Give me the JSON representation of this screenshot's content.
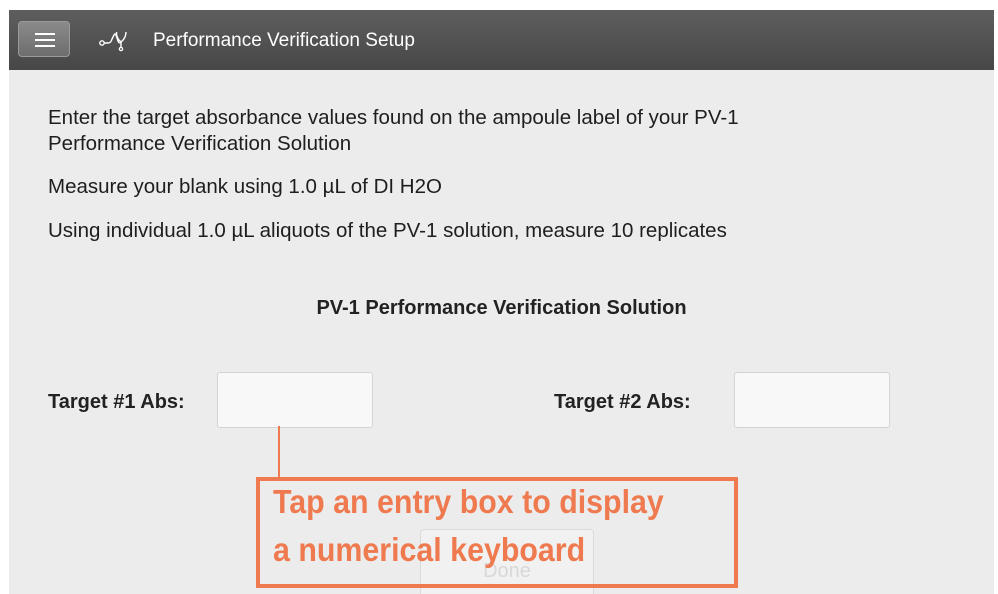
{
  "header": {
    "title": "Performance Verification Setup",
    "menu_icon": "hamburger-menu-icon",
    "app_icon": "stethoscope-icon"
  },
  "instructions": [
    "Enter the target absorbance values found on the ampoule label of your PV-1",
    "Performance Verification Solution",
    "Measure your blank using 1.0 µL of DI H2O",
    "Using individual 1.0 µL aliquots of the PV-1 solution, measure 10 replicates"
  ],
  "section_title": "PV-1 Performance Verification Solution",
  "fields": {
    "target1": {
      "label": "Target #1 Abs:",
      "value": ""
    },
    "target2": {
      "label": "Target #2 Abs:",
      "value": ""
    }
  },
  "done_button": {
    "label": "Done"
  },
  "callout": {
    "line1": "Tap an entry box to display",
    "line2": "a numerical keyboard",
    "color": "#ef7a4f"
  },
  "colors": {
    "titlebar": "#4f4f4f",
    "background": "#ececec"
  }
}
